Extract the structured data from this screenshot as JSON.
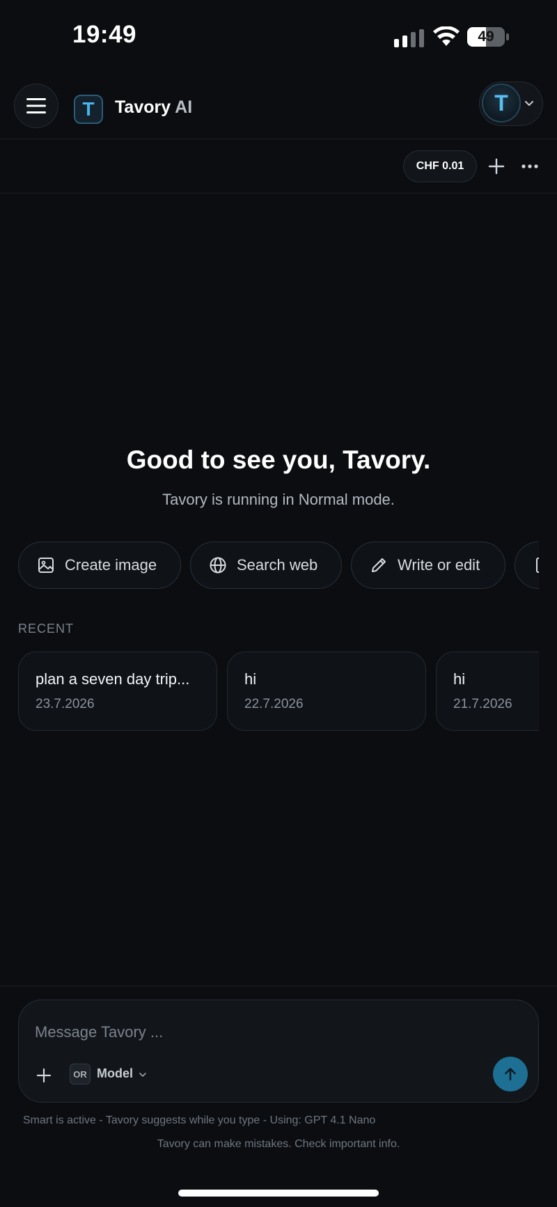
{
  "status_bar": {
    "time": "19:49",
    "battery": "49"
  },
  "header": {
    "logo_letter": "T",
    "app_name": "Tavory",
    "app_suffix": "AI",
    "avatar_letter": "T"
  },
  "toolbar": {
    "credit": "CHF 0.01"
  },
  "greeting": {
    "title": "Good to see you, Tavory.",
    "subtitle": "Tavory is running in Normal mode."
  },
  "quick_actions": [
    {
      "label": "Create image",
      "icon": "image-icon"
    },
    {
      "label": "Search web",
      "icon": "globe-icon"
    },
    {
      "label": "Write or edit",
      "icon": "pencil-icon"
    }
  ],
  "recent": {
    "label": "RECENT",
    "items": [
      {
        "title": "plan a seven day trip...",
        "date": "23.7.2026"
      },
      {
        "title": "hi",
        "date": "22.7.2026"
      },
      {
        "title": "hi",
        "date": "21.7.2026"
      }
    ]
  },
  "composer": {
    "placeholder": "Message Tavory ...",
    "model_badge": "OR",
    "model_label": "Model"
  },
  "footer": {
    "smart_note": "Smart is active - Tavory suggests while you type - Using: GPT 4.1 Nano",
    "disclaimer": "Tavory can make mistakes. Check important info."
  },
  "colors": {
    "accent": "#1d6f93",
    "logo_blue": "#49b3ec",
    "background": "#0b0d11"
  }
}
